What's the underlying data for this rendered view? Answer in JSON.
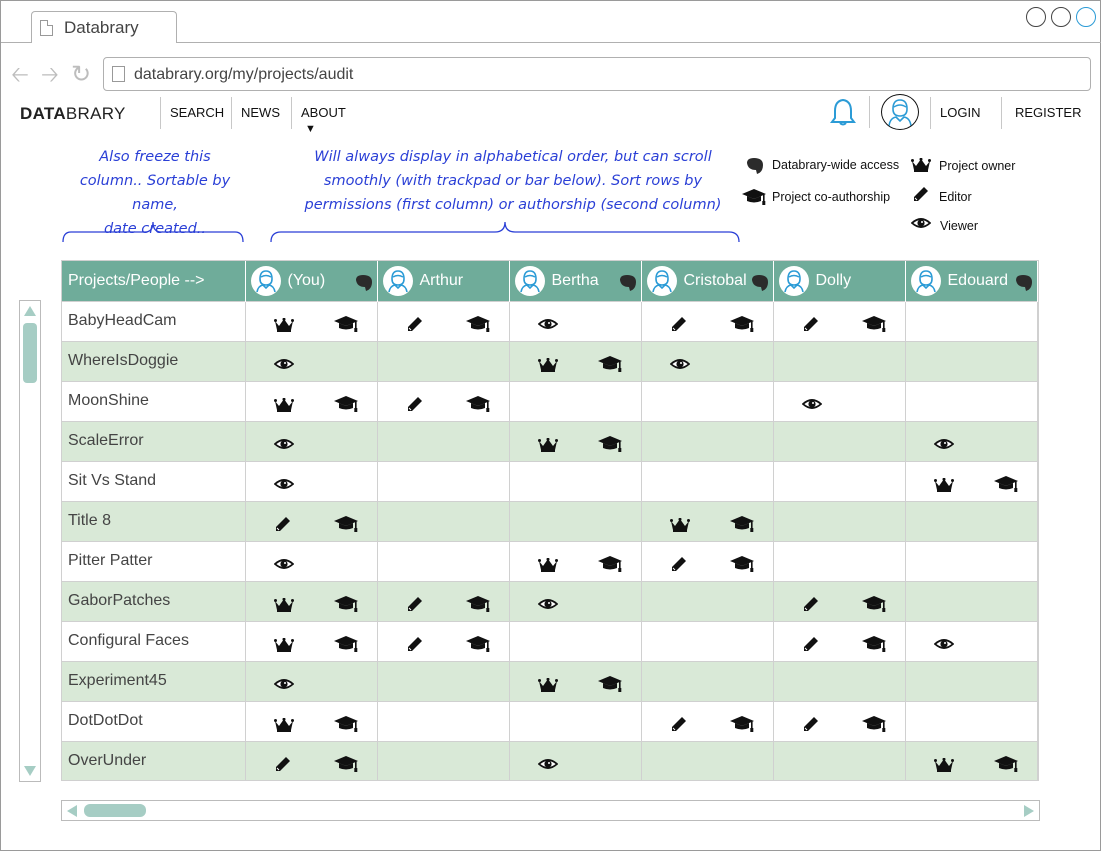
{
  "browser": {
    "tab_title": "Databrary",
    "url": "databrary.org/my/projects/audit"
  },
  "header": {
    "logo_bold": "DATA",
    "logo_rest": "BRARY",
    "nav": [
      "SEARCH",
      "NEWS",
      "ABOUT"
    ],
    "login": "LOGIN",
    "register": "REGISTER"
  },
  "annotations": {
    "left": [
      "Also freeze this",
      "column.. Sortable by name,",
      "date created.."
    ],
    "right": [
      "Will always display in alphabetical order, but can scroll",
      "smoothly (with trackpad or bar below). Sort rows by",
      "permissions (first column) or authorship (second column)"
    ]
  },
  "legend": {
    "access": "Databrary-wide access",
    "owner": "Project owner",
    "coauthor": "Project co-authorship",
    "editor": "Editor",
    "viewer": "Viewer"
  },
  "table": {
    "corner": "Projects/People -->",
    "people": [
      {
        "name": "(You)",
        "access": true
      },
      {
        "name": "Arthur",
        "access": false
      },
      {
        "name": "Bertha",
        "access": true
      },
      {
        "name": "Cristobal",
        "access": true
      },
      {
        "name": "Dolly",
        "access": false
      },
      {
        "name": "Edouard",
        "access": true
      }
    ],
    "rows": [
      {
        "project": "BabyHeadCam",
        "cells": [
          [
            "owner",
            "coauthor"
          ],
          [
            "editor",
            "coauthor"
          ],
          [
            "viewer",
            ""
          ],
          [
            "editor",
            "coauthor"
          ],
          [
            "editor",
            "coauthor"
          ],
          [
            "",
            ""
          ]
        ]
      },
      {
        "project": "WhereIsDoggie",
        "cells": [
          [
            "viewer",
            ""
          ],
          [
            "",
            ""
          ],
          [
            "owner",
            "coauthor"
          ],
          [
            "viewer",
            ""
          ],
          [
            "",
            ""
          ],
          [
            "",
            ""
          ]
        ]
      },
      {
        "project": "MoonShine",
        "cells": [
          [
            "owner",
            "coauthor"
          ],
          [
            "editor",
            "coauthor"
          ],
          [
            "",
            ""
          ],
          [
            "",
            ""
          ],
          [
            "viewer",
            ""
          ],
          [
            "",
            ""
          ]
        ]
      },
      {
        "project": "ScaleError",
        "cells": [
          [
            "viewer",
            ""
          ],
          [
            "",
            ""
          ],
          [
            "owner",
            "coauthor"
          ],
          [
            "",
            ""
          ],
          [
            "",
            ""
          ],
          [
            "viewer",
            ""
          ]
        ]
      },
      {
        "project": "Sit Vs Stand",
        "cells": [
          [
            "viewer",
            ""
          ],
          [
            "",
            ""
          ],
          [
            "",
            ""
          ],
          [
            "",
            ""
          ],
          [
            "",
            ""
          ],
          [
            "owner",
            "coauthor"
          ]
        ]
      },
      {
        "project": "Title 8",
        "cells": [
          [
            "editor",
            "coauthor"
          ],
          [
            "",
            ""
          ],
          [
            "",
            ""
          ],
          [
            "owner",
            "coauthor"
          ],
          [
            "",
            ""
          ],
          [
            "",
            ""
          ]
        ]
      },
      {
        "project": "Pitter Patter",
        "cells": [
          [
            "viewer",
            ""
          ],
          [
            "",
            ""
          ],
          [
            "owner",
            "coauthor"
          ],
          [
            "editor",
            "coauthor"
          ],
          [
            "",
            ""
          ],
          [
            "",
            ""
          ]
        ]
      },
      {
        "project": "GaborPatches",
        "cells": [
          [
            "owner",
            "coauthor"
          ],
          [
            "editor",
            "coauthor"
          ],
          [
            "viewer",
            ""
          ],
          [
            "",
            ""
          ],
          [
            "editor",
            "coauthor"
          ],
          [
            "",
            ""
          ]
        ]
      },
      {
        "project": "Configural Faces",
        "cells": [
          [
            "owner",
            "coauthor"
          ],
          [
            "editor",
            "coauthor"
          ],
          [
            "",
            ""
          ],
          [
            "",
            ""
          ],
          [
            "editor",
            "coauthor"
          ],
          [
            "viewer",
            ""
          ]
        ]
      },
      {
        "project": "Experiment45",
        "cells": [
          [
            "viewer",
            ""
          ],
          [
            "",
            ""
          ],
          [
            "owner",
            "coauthor"
          ],
          [
            "",
            ""
          ],
          [
            "",
            ""
          ],
          [
            "",
            ""
          ]
        ]
      },
      {
        "project": "DotDotDot",
        "cells": [
          [
            "owner",
            "coauthor"
          ],
          [
            "",
            ""
          ],
          [
            "",
            ""
          ],
          [
            "editor",
            "coauthor"
          ],
          [
            "editor",
            "coauthor"
          ],
          [
            "",
            ""
          ]
        ]
      },
      {
        "project": "OverUnder",
        "cells": [
          [
            "editor",
            "coauthor"
          ],
          [
            "",
            ""
          ],
          [
            "viewer",
            ""
          ],
          [
            "",
            ""
          ],
          [
            "",
            ""
          ],
          [
            "owner",
            "coauthor"
          ]
        ]
      }
    ]
  },
  "colors": {
    "header_green": "#6fac9a",
    "alt_row": "#d9e9d7",
    "annotation_blue": "#2a3fd6",
    "accent_blue": "#2b9bd6"
  }
}
